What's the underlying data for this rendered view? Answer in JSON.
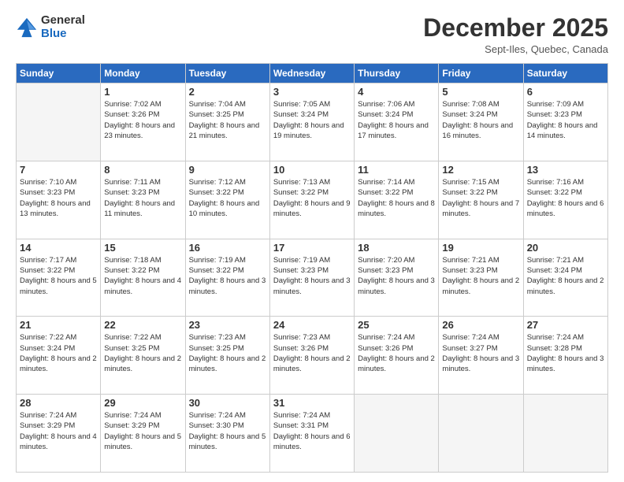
{
  "logo": {
    "general": "General",
    "blue": "Blue"
  },
  "header": {
    "month": "December 2025",
    "location": "Sept-Iles, Quebec, Canada"
  },
  "weekdays": [
    "Sunday",
    "Monday",
    "Tuesday",
    "Wednesday",
    "Thursday",
    "Friday",
    "Saturday"
  ],
  "weeks": [
    [
      {
        "day": "",
        "empty": true
      },
      {
        "day": "1",
        "sunrise": "7:02 AM",
        "sunset": "3:26 PM",
        "daylight": "8 hours and 23 minutes."
      },
      {
        "day": "2",
        "sunrise": "7:04 AM",
        "sunset": "3:25 PM",
        "daylight": "8 hours and 21 minutes."
      },
      {
        "day": "3",
        "sunrise": "7:05 AM",
        "sunset": "3:24 PM",
        "daylight": "8 hours and 19 minutes."
      },
      {
        "day": "4",
        "sunrise": "7:06 AM",
        "sunset": "3:24 PM",
        "daylight": "8 hours and 17 minutes."
      },
      {
        "day": "5",
        "sunrise": "7:08 AM",
        "sunset": "3:24 PM",
        "daylight": "8 hours and 16 minutes."
      },
      {
        "day": "6",
        "sunrise": "7:09 AM",
        "sunset": "3:23 PM",
        "daylight": "8 hours and 14 minutes."
      }
    ],
    [
      {
        "day": "7",
        "sunrise": "7:10 AM",
        "sunset": "3:23 PM",
        "daylight": "8 hours and 13 minutes."
      },
      {
        "day": "8",
        "sunrise": "7:11 AM",
        "sunset": "3:23 PM",
        "daylight": "8 hours and 11 minutes."
      },
      {
        "day": "9",
        "sunrise": "7:12 AM",
        "sunset": "3:22 PM",
        "daylight": "8 hours and 10 minutes."
      },
      {
        "day": "10",
        "sunrise": "7:13 AM",
        "sunset": "3:22 PM",
        "daylight": "8 hours and 9 minutes."
      },
      {
        "day": "11",
        "sunrise": "7:14 AM",
        "sunset": "3:22 PM",
        "daylight": "8 hours and 8 minutes."
      },
      {
        "day": "12",
        "sunrise": "7:15 AM",
        "sunset": "3:22 PM",
        "daylight": "8 hours and 7 minutes."
      },
      {
        "day": "13",
        "sunrise": "7:16 AM",
        "sunset": "3:22 PM",
        "daylight": "8 hours and 6 minutes."
      }
    ],
    [
      {
        "day": "14",
        "sunrise": "7:17 AM",
        "sunset": "3:22 PM",
        "daylight": "8 hours and 5 minutes."
      },
      {
        "day": "15",
        "sunrise": "7:18 AM",
        "sunset": "3:22 PM",
        "daylight": "8 hours and 4 minutes."
      },
      {
        "day": "16",
        "sunrise": "7:19 AM",
        "sunset": "3:22 PM",
        "daylight": "8 hours and 3 minutes."
      },
      {
        "day": "17",
        "sunrise": "7:19 AM",
        "sunset": "3:23 PM",
        "daylight": "8 hours and 3 minutes."
      },
      {
        "day": "18",
        "sunrise": "7:20 AM",
        "sunset": "3:23 PM",
        "daylight": "8 hours and 3 minutes."
      },
      {
        "day": "19",
        "sunrise": "7:21 AM",
        "sunset": "3:23 PM",
        "daylight": "8 hours and 2 minutes."
      },
      {
        "day": "20",
        "sunrise": "7:21 AM",
        "sunset": "3:24 PM",
        "daylight": "8 hours and 2 minutes."
      }
    ],
    [
      {
        "day": "21",
        "sunrise": "7:22 AM",
        "sunset": "3:24 PM",
        "daylight": "8 hours and 2 minutes."
      },
      {
        "day": "22",
        "sunrise": "7:22 AM",
        "sunset": "3:25 PM",
        "daylight": "8 hours and 2 minutes."
      },
      {
        "day": "23",
        "sunrise": "7:23 AM",
        "sunset": "3:25 PM",
        "daylight": "8 hours and 2 minutes."
      },
      {
        "day": "24",
        "sunrise": "7:23 AM",
        "sunset": "3:26 PM",
        "daylight": "8 hours and 2 minutes."
      },
      {
        "day": "25",
        "sunrise": "7:24 AM",
        "sunset": "3:26 PM",
        "daylight": "8 hours and 2 minutes."
      },
      {
        "day": "26",
        "sunrise": "7:24 AM",
        "sunset": "3:27 PM",
        "daylight": "8 hours and 3 minutes."
      },
      {
        "day": "27",
        "sunrise": "7:24 AM",
        "sunset": "3:28 PM",
        "daylight": "8 hours and 3 minutes."
      }
    ],
    [
      {
        "day": "28",
        "sunrise": "7:24 AM",
        "sunset": "3:29 PM",
        "daylight": "8 hours and 4 minutes."
      },
      {
        "day": "29",
        "sunrise": "7:24 AM",
        "sunset": "3:29 PM",
        "daylight": "8 hours and 5 minutes."
      },
      {
        "day": "30",
        "sunrise": "7:24 AM",
        "sunset": "3:30 PM",
        "daylight": "8 hours and 5 minutes."
      },
      {
        "day": "31",
        "sunrise": "7:24 AM",
        "sunset": "3:31 PM",
        "daylight": "8 hours and 6 minutes."
      },
      {
        "day": "",
        "empty": true
      },
      {
        "day": "",
        "empty": true
      },
      {
        "day": "",
        "empty": true
      }
    ]
  ]
}
